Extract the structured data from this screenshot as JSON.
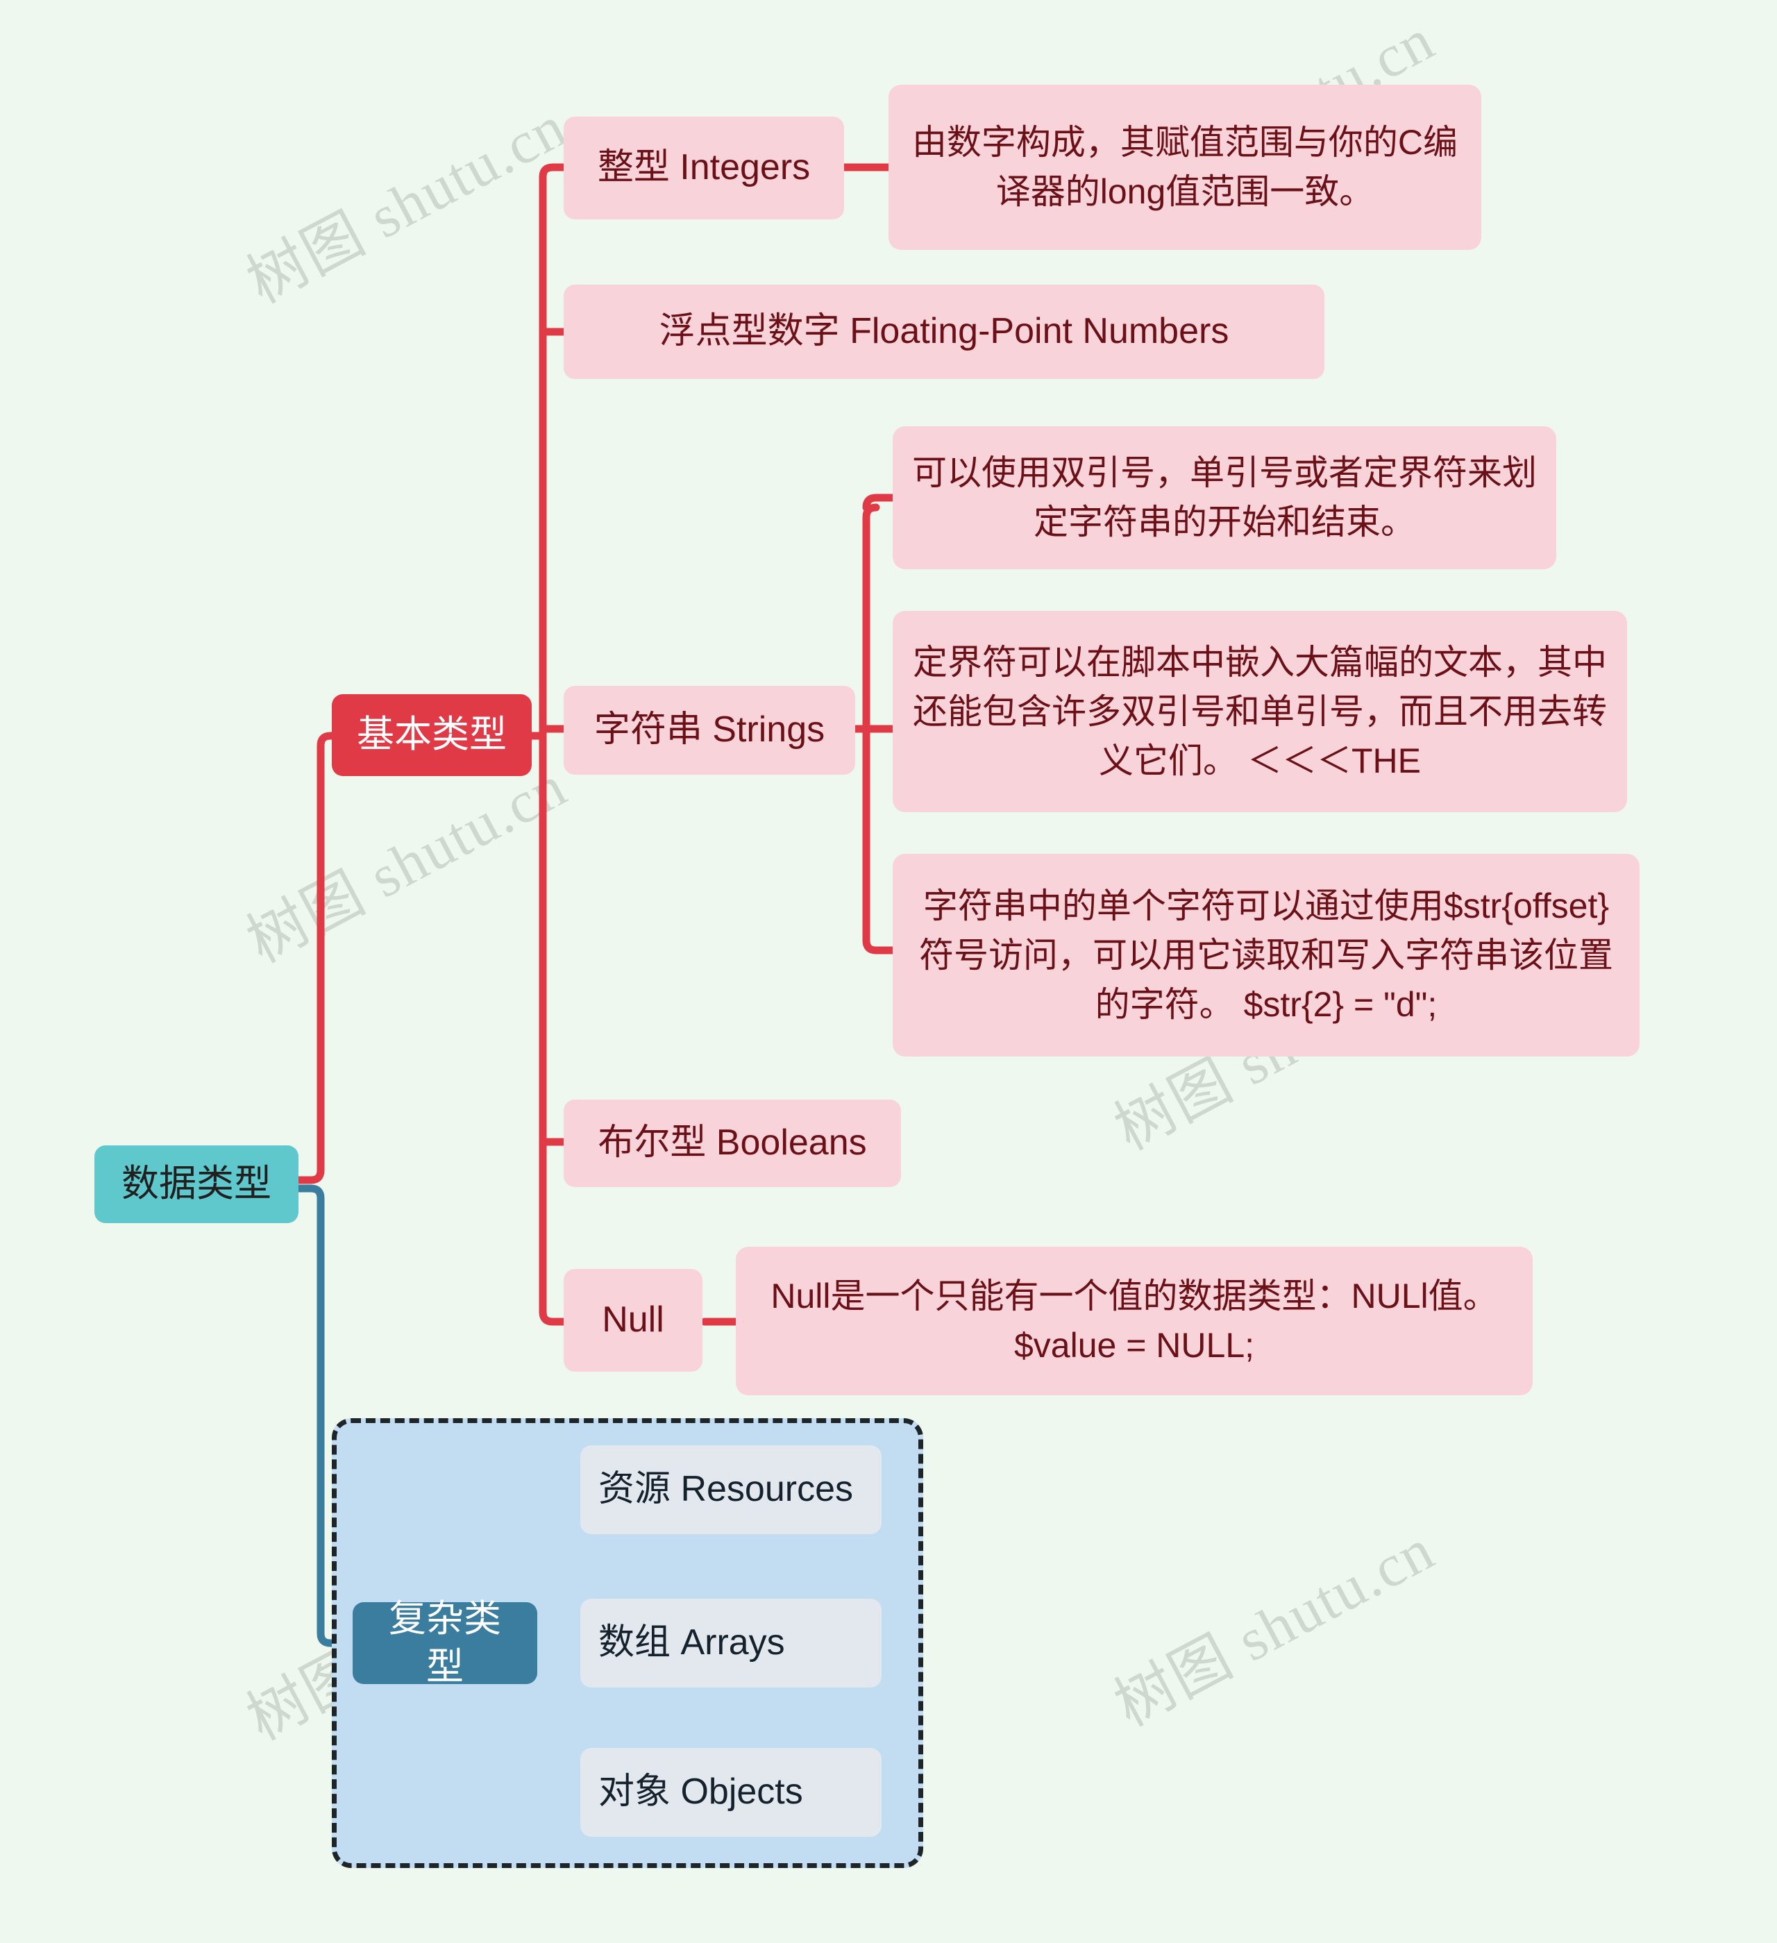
{
  "meta": {
    "watermark_text": "树图 shutu.cn",
    "background_color": "#eff8ef",
    "root_color": "#5ec8cd",
    "basic_branch_color": "#e03a47",
    "complex_branch_color": "#3a7d9e",
    "pink_node_color": "#f9d3da",
    "grey_node_color": "#e2e8ed"
  },
  "root": {
    "label": "数据类型"
  },
  "basic": {
    "label": "基本类型",
    "children": {
      "integers": {
        "label": "整型 Integers",
        "note": "由数字构成，其赋值范围与你的C编译器的long值范围一致。"
      },
      "floats": {
        "label": "浮点型数字 Floating-Point Numbers"
      },
      "strings": {
        "label": "字符串 Strings",
        "notes": [
          "可以使用双引号，单引号或者定界符来划定字符串的开始和结束。",
          "定界符可以在脚本中嵌入大篇幅的文本，其中还能包含许多双引号和单引号，而且不用去转义它们。 ＜＜＜THE",
          "字符串中的单个字符可以通过使用$str{offset}符号访问，可以用它读取和写入字符串该位置的字符。 $str{2} = \"d\";"
        ]
      },
      "booleans": {
        "label": "布尔型 Booleans"
      },
      "null": {
        "label": "Null",
        "note": "Null是一个只能有一个值的数据类型：NULl值。$value = NULL;"
      }
    }
  },
  "complex": {
    "label": "复杂类型",
    "children": [
      {
        "label": "资源 Resources"
      },
      {
        "label": "数组 Arrays"
      },
      {
        "label": "对象 Objects"
      }
    ]
  }
}
